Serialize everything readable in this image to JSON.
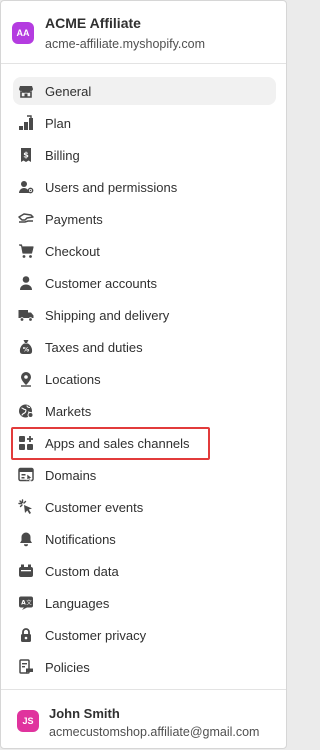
{
  "store": {
    "initials": "AA",
    "name": "ACME Affiliate",
    "domain": "acme-affiliate.myshopify.com",
    "avatar_color": "#b43ce0"
  },
  "nav": {
    "active": "General",
    "highlighted": "Apps and sales channels",
    "items": [
      {
        "label": "General",
        "icon": "store-icon"
      },
      {
        "label": "Plan",
        "icon": "plan-icon"
      },
      {
        "label": "Billing",
        "icon": "billing-icon"
      },
      {
        "label": "Users and permissions",
        "icon": "users-icon"
      },
      {
        "label": "Payments",
        "icon": "payments-icon"
      },
      {
        "label": "Checkout",
        "icon": "cart-icon"
      },
      {
        "label": "Customer accounts",
        "icon": "person-icon"
      },
      {
        "label": "Shipping and delivery",
        "icon": "truck-icon"
      },
      {
        "label": "Taxes and duties",
        "icon": "tax-bag-icon"
      },
      {
        "label": "Locations",
        "icon": "location-pin-icon"
      },
      {
        "label": "Markets",
        "icon": "globe-icon"
      },
      {
        "label": "Apps and sales channels",
        "icon": "apps-icon"
      },
      {
        "label": "Domains",
        "icon": "domain-icon"
      },
      {
        "label": "Customer events",
        "icon": "cursor-click-icon"
      },
      {
        "label": "Notifications",
        "icon": "bell-icon"
      },
      {
        "label": "Custom data",
        "icon": "database-icon"
      },
      {
        "label": "Languages",
        "icon": "language-icon"
      },
      {
        "label": "Customer privacy",
        "icon": "lock-icon"
      },
      {
        "label": "Policies",
        "icon": "policy-icon"
      }
    ]
  },
  "user": {
    "initials": "JS",
    "name": "John Smith",
    "email": "acmecustomshop.affiliate@gmail.com",
    "avatar_color": "#e0339e"
  },
  "colors": {
    "highlight_border": "#e23b3b",
    "active_background": "#f1f1f1",
    "icon": "#4a4a4a"
  }
}
